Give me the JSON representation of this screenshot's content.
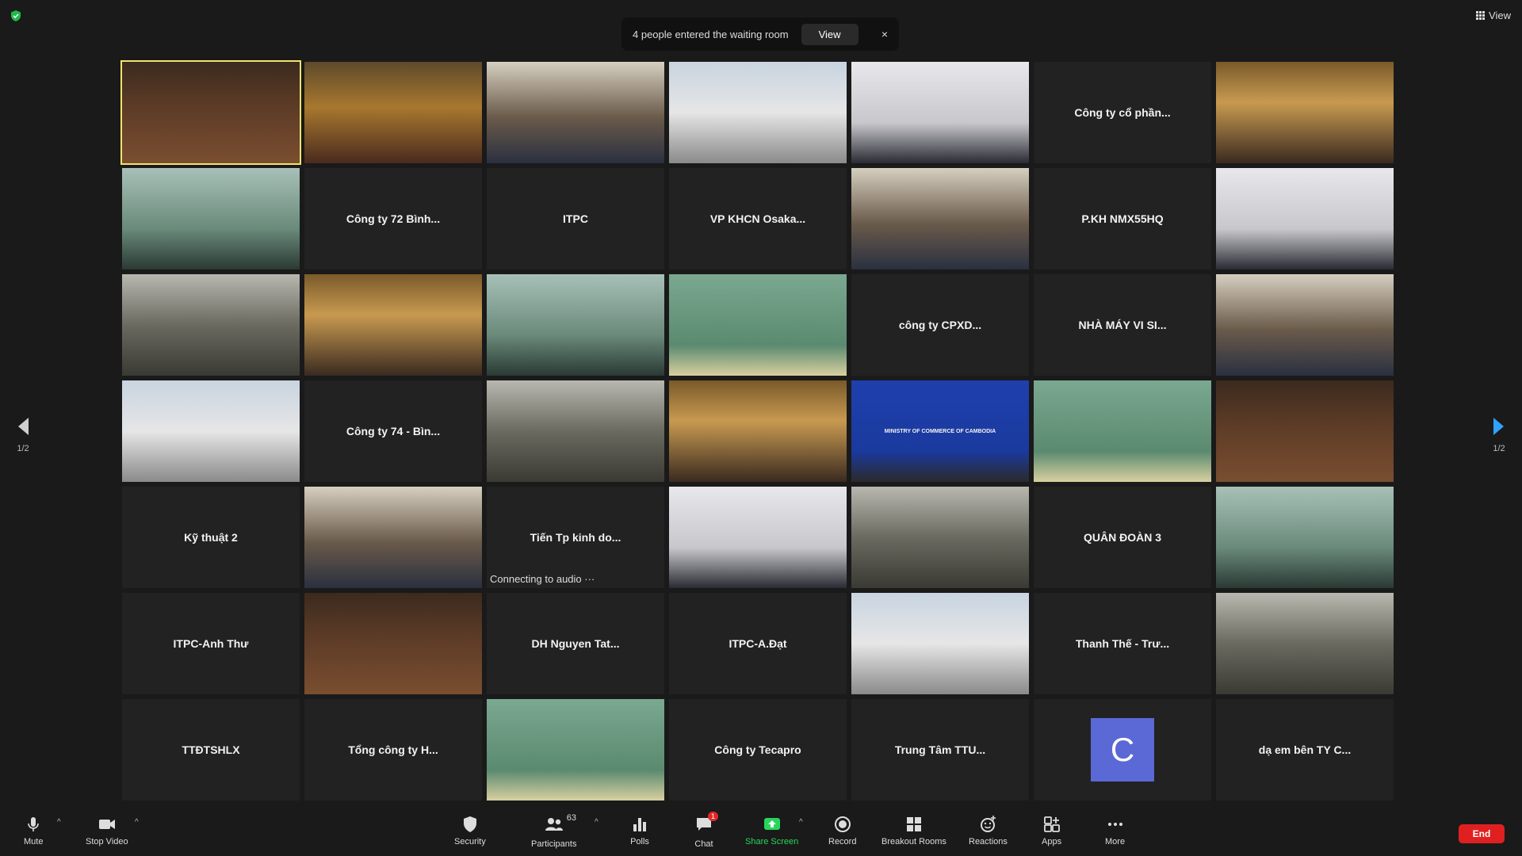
{
  "top": {
    "view_label": "View"
  },
  "notification": {
    "text": "4 people entered the waiting room",
    "button": "View",
    "close": "×"
  },
  "pagination": {
    "left": "1/2",
    "right": "1/2"
  },
  "tiles": [
    {
      "type": "video",
      "label": ""
    },
    {
      "type": "video",
      "label": ""
    },
    {
      "type": "video",
      "label": ""
    },
    {
      "type": "video",
      "label": ""
    },
    {
      "type": "video",
      "label": ""
    },
    {
      "type": "name",
      "label": "Công ty cổ phần..."
    },
    {
      "type": "video",
      "label": ""
    },
    {
      "type": "video",
      "label": ""
    },
    {
      "type": "name",
      "label": "Công ty 72 Bình..."
    },
    {
      "type": "name",
      "label": "ITPC"
    },
    {
      "type": "name",
      "label": "VP KHCN Osaka..."
    },
    {
      "type": "video",
      "label": ""
    },
    {
      "type": "name",
      "label": "P.KH NMX55HQ"
    },
    {
      "type": "video",
      "label": ""
    },
    {
      "type": "video",
      "label": ""
    },
    {
      "type": "video",
      "label": ""
    },
    {
      "type": "video",
      "label": ""
    },
    {
      "type": "video",
      "label": ""
    },
    {
      "type": "name",
      "label": "công ty  CPXD..."
    },
    {
      "type": "name",
      "label": "NHÀ MÁY VI SI..."
    },
    {
      "type": "video",
      "label": ""
    },
    {
      "type": "video",
      "label": ""
    },
    {
      "type": "name",
      "label": "Công ty 74 - Bìn..."
    },
    {
      "type": "video",
      "label": ""
    },
    {
      "type": "video",
      "label": ""
    },
    {
      "type": "video",
      "label": "MINISTRY OF COMMERCE OF CAMBODIA"
    },
    {
      "type": "video",
      "label": ""
    },
    {
      "type": "video",
      "label": ""
    },
    {
      "type": "name",
      "label": "Kỹ thuật 2"
    },
    {
      "type": "video",
      "label": ""
    },
    {
      "type": "name",
      "label": "Tiến Tp kinh do...",
      "status": "Connecting to audio ···"
    },
    {
      "type": "video",
      "label": ""
    },
    {
      "type": "video",
      "label": ""
    },
    {
      "type": "name",
      "label": "QUÂN ĐOÀN 3"
    },
    {
      "type": "video",
      "label": ""
    },
    {
      "type": "name",
      "label": "ITPC-Anh Thư"
    },
    {
      "type": "video",
      "label": ""
    },
    {
      "type": "name",
      "label": "DH Nguyen Tat..."
    },
    {
      "type": "name",
      "label": "ITPC-A.Đạt"
    },
    {
      "type": "video",
      "label": ""
    },
    {
      "type": "name",
      "label": "Thanh Thế - Trư..."
    },
    {
      "type": "video",
      "label": ""
    },
    {
      "type": "name",
      "label": "TTĐTSHLX"
    },
    {
      "type": "name",
      "label": "Tổng công ty H..."
    },
    {
      "type": "video",
      "label": ""
    },
    {
      "type": "name",
      "label": "Công ty Tecapro"
    },
    {
      "type": "name",
      "label": "Trung Tâm TTU..."
    },
    {
      "type": "avatar",
      "label": "C"
    },
    {
      "type": "name",
      "label": "dạ em bên TY C..."
    }
  ],
  "toolbar": {
    "mute": "Mute",
    "stop_video": "Stop Video",
    "security": "Security",
    "participants": "Participants",
    "participants_count": "63",
    "polls": "Polls",
    "chat": "Chat",
    "chat_badge": "1",
    "share_screen": "Share Screen",
    "record": "Record",
    "breakout_rooms": "Breakout Rooms",
    "reactions": "Reactions",
    "apps": "Apps",
    "more": "More",
    "end": "End"
  },
  "colors": {
    "accent_green": "#27d65a",
    "end_red": "#e02020",
    "active_border": "#f0e36a",
    "avatar": "#5b69d6"
  }
}
